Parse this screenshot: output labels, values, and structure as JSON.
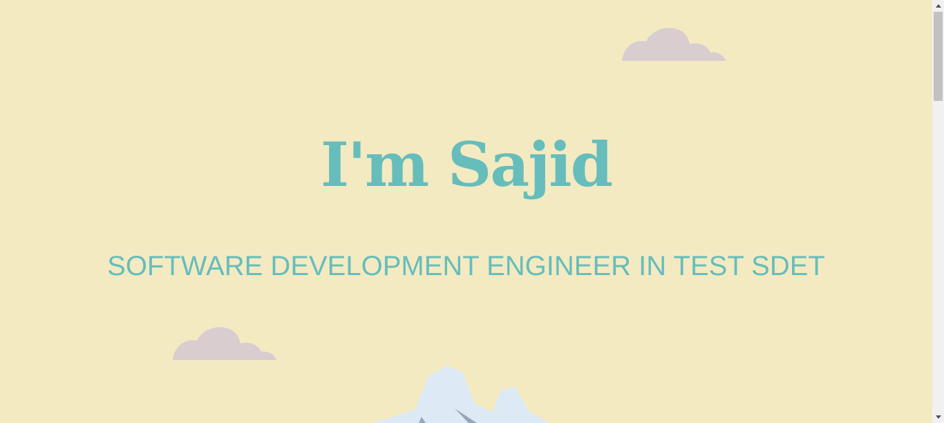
{
  "hero": {
    "title": "I'm Sajid",
    "subtitle": "SOFTWARE DEVELOPMENT ENGINEER IN TEST SDET"
  },
  "colors": {
    "background": "#f3eac2",
    "accent": "#66bdbb",
    "cloud": "#d9cdd0",
    "mountain_snow": "#ddeaf6",
    "mountain_shadow": "#98a7b8"
  },
  "icons": {
    "cloud_top": "cloud-icon",
    "cloud_mid": "cloud-icon",
    "mountain": "mountain-icon",
    "scroll_up": "scroll-up-arrow-icon",
    "scroll_down": "scroll-down-arrow-icon"
  }
}
